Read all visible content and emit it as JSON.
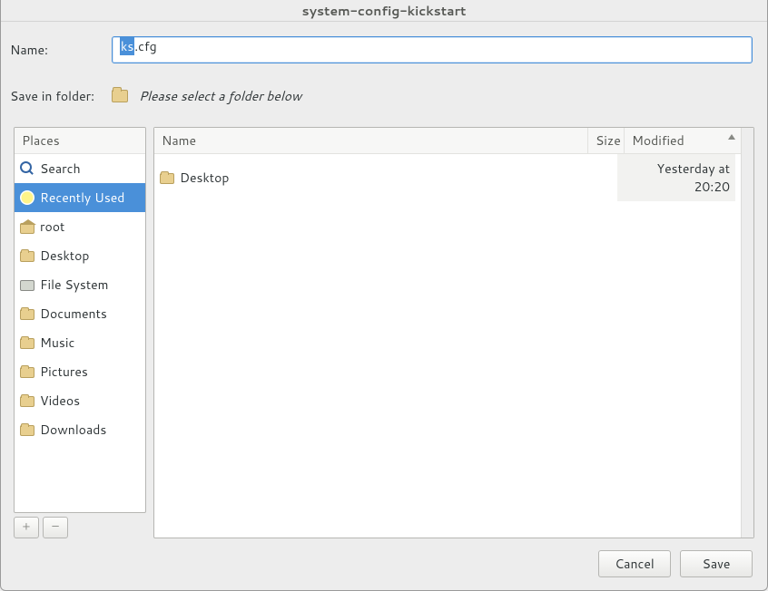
{
  "window": {
    "title": "system-config-kickstart"
  },
  "form": {
    "name_label": "Name:",
    "filename_prefix_selected": "ks",
    "filename_suffix": ".cfg",
    "save_in_label": "Save in folder:",
    "folder_hint": "Please select a folder below"
  },
  "places": {
    "header": "Places",
    "items": [
      {
        "label": "Search",
        "icon": "search-icon",
        "selected": false
      },
      {
        "label": "Recently Used",
        "icon": "clock-icon",
        "selected": true
      },
      {
        "label": "root",
        "icon": "home-icon",
        "selected": false
      },
      {
        "label": "Desktop",
        "icon": "desktop-icon",
        "selected": false
      },
      {
        "label": "File System",
        "icon": "disk-icon",
        "selected": false
      },
      {
        "label": "Documents",
        "icon": "folder-icon",
        "selected": false
      },
      {
        "label": "Music",
        "icon": "folder-icon",
        "selected": false
      },
      {
        "label": "Pictures",
        "icon": "folder-icon",
        "selected": false
      },
      {
        "label": "Videos",
        "icon": "folder-icon",
        "selected": false
      },
      {
        "label": "Downloads",
        "icon": "folder-icon",
        "selected": false
      }
    ],
    "add_btn": "+",
    "remove_btn": "–"
  },
  "files": {
    "columns": {
      "name": "Name",
      "size": "Size",
      "modified": "Modified"
    },
    "rows": [
      {
        "name": "Desktop",
        "icon": "folder-icon",
        "size": "",
        "modified": "Yesterday at 20:20"
      }
    ]
  },
  "actions": {
    "cancel": "Cancel",
    "save": "Save"
  }
}
